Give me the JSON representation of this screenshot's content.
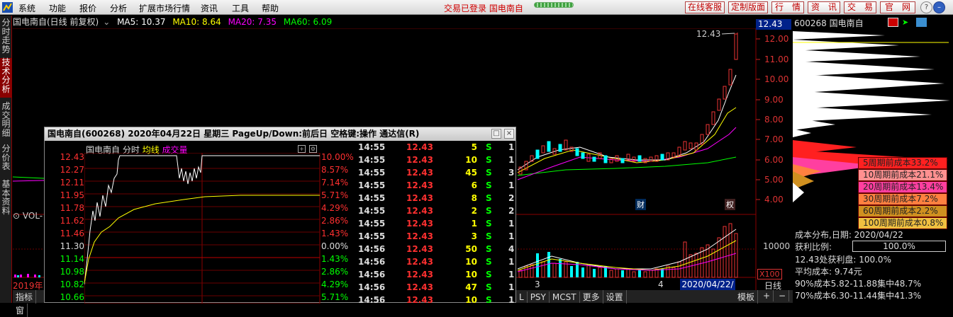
{
  "menubar": {
    "items": [
      "系统",
      "功能",
      "报价",
      "分析",
      "扩展市场行情",
      "资讯",
      "工具",
      "帮助"
    ],
    "login_status": "交易已登录",
    "stock_name": "国电南自",
    "buttons": [
      "在线客服",
      "定制版面",
      "行　情",
      "资　讯",
      "交　易",
      "官　网"
    ],
    "window_controls": [
      "?",
      "–",
      "□",
      "×"
    ]
  },
  "left_tabs": [
    {
      "label": "分时走势",
      "active": false
    },
    {
      "label": "技术分析",
      "active": true
    },
    {
      "label": "成交明细",
      "active": false
    },
    {
      "label": "分价表",
      "active": false
    },
    {
      "label": "基本资料",
      "active": false
    }
  ],
  "chart": {
    "title": "国电南自(日线 前复权)",
    "ma5": "MA5: 10.37",
    "ma10": "MA10: 8.64",
    "ma20": "MA20: 7.35",
    "ma60": "MA60: 6.09",
    "current_price": "12.43",
    "high_label": "12.43",
    "y_ticks": [
      "12.00",
      "11.00",
      "10.00",
      "9.00",
      "8.00",
      "7.00",
      "6.00",
      "5.00",
      "4.00"
    ],
    "vol_tick": "10000",
    "vol_scale": "X100",
    "year_label": "2019年",
    "month_labels": [
      "3",
      "4"
    ],
    "event_labels": [
      "财",
      "权"
    ],
    "vol_label": "VOL-",
    "date_box": "2020/04/22/三",
    "period": "日线",
    "indicator_tabs": [
      "指标",
      "窗"
    ],
    "bottom_tabs": [
      "L",
      "PSY",
      "MCST",
      "更多",
      "设置"
    ],
    "bottom_right": [
      "模板",
      "+",
      "−"
    ]
  },
  "right_panel": {
    "code_name": "600268 国电南自",
    "legend": [
      {
        "label": "5周期前成本33.2%",
        "color": "#ff2020"
      },
      {
        "label": "10周期前成本21.1%",
        "color": "#ff9090"
      },
      {
        "label": "20周期前成本13.4%",
        "color": "#ff3fa0"
      },
      {
        "label": "30周期前成本7.2%",
        "color": "#ff8040"
      },
      {
        "label": "60周期前成本2.2%",
        "color": "#d09020"
      },
      {
        "label": "100周期前成本0.8%",
        "color": "#f0c040"
      }
    ],
    "dist_date": "成本分布,日期: 2020/04/22",
    "profit_label": "获利比例:",
    "profit_value": "100.0%",
    "profit_line": "12.43处获利盘: 100.0%",
    "avg_cost": "平均成本: 9.74元",
    "cost90": "90%成本5.82-11.88集中48.7%",
    "cost70": "70%成本6.30-11.44集中41.3%",
    "progress": 1.0
  },
  "popup": {
    "title": "国电南自(600268)  2020年04月22日  星期三  PageUp/Down:前后日  空格键:操作  通达信(R)",
    "header_name": "国电南自",
    "header_mode": "分时",
    "header_avg": "均线",
    "header_vol": "成交量",
    "left_prices": [
      "12.43",
      "12.27",
      "12.11",
      "11.95",
      "11.78",
      "11.62",
      "11.46",
      "11.30",
      "11.14",
      "10.98",
      "10.82",
      "10.66"
    ],
    "right_pcts": [
      "10.00%",
      "8.57%",
      "7.14%",
      "5.71%",
      "4.29%",
      "2.86%",
      "1.43%",
      "0.00%",
      "1.43%",
      "2.86%",
      "4.29%",
      "5.71%"
    ],
    "ticks": [
      {
        "time": "14:55",
        "price": "12.43",
        "vol": "5",
        "side": "S",
        "cnt": "1"
      },
      {
        "time": "14:55",
        "price": "12.43",
        "vol": "10",
        "side": "S",
        "cnt": "1"
      },
      {
        "time": "14:55",
        "price": "12.43",
        "vol": "45",
        "side": "S",
        "cnt": "3"
      },
      {
        "time": "14:55",
        "price": "12.43",
        "vol": "6",
        "side": "S",
        "cnt": "1"
      },
      {
        "time": "14:55",
        "price": "12.43",
        "vol": "8",
        "side": "S",
        "cnt": "2"
      },
      {
        "time": "14:55",
        "price": "12.43",
        "vol": "2",
        "side": "S",
        "cnt": "2"
      },
      {
        "time": "14:55",
        "price": "12.43",
        "vol": "1",
        "side": "S",
        "cnt": "1"
      },
      {
        "time": "14:55",
        "price": "12.43",
        "vol": "3",
        "side": "S",
        "cnt": "1"
      },
      {
        "time": "14:56",
        "price": "12.43",
        "vol": "50",
        "side": "S",
        "cnt": "4"
      },
      {
        "time": "14:56",
        "price": "12.43",
        "vol": "10",
        "side": "S",
        "cnt": "1"
      },
      {
        "time": "14:56",
        "price": "12.43",
        "vol": "10",
        "side": "S",
        "cnt": "1"
      },
      {
        "time": "14:56",
        "price": "12.43",
        "vol": "47",
        "side": "S",
        "cnt": "1"
      },
      {
        "time": "14:56",
        "price": "12.43",
        "vol": "10",
        "side": "S",
        "cnt": "1"
      }
    ]
  }
}
